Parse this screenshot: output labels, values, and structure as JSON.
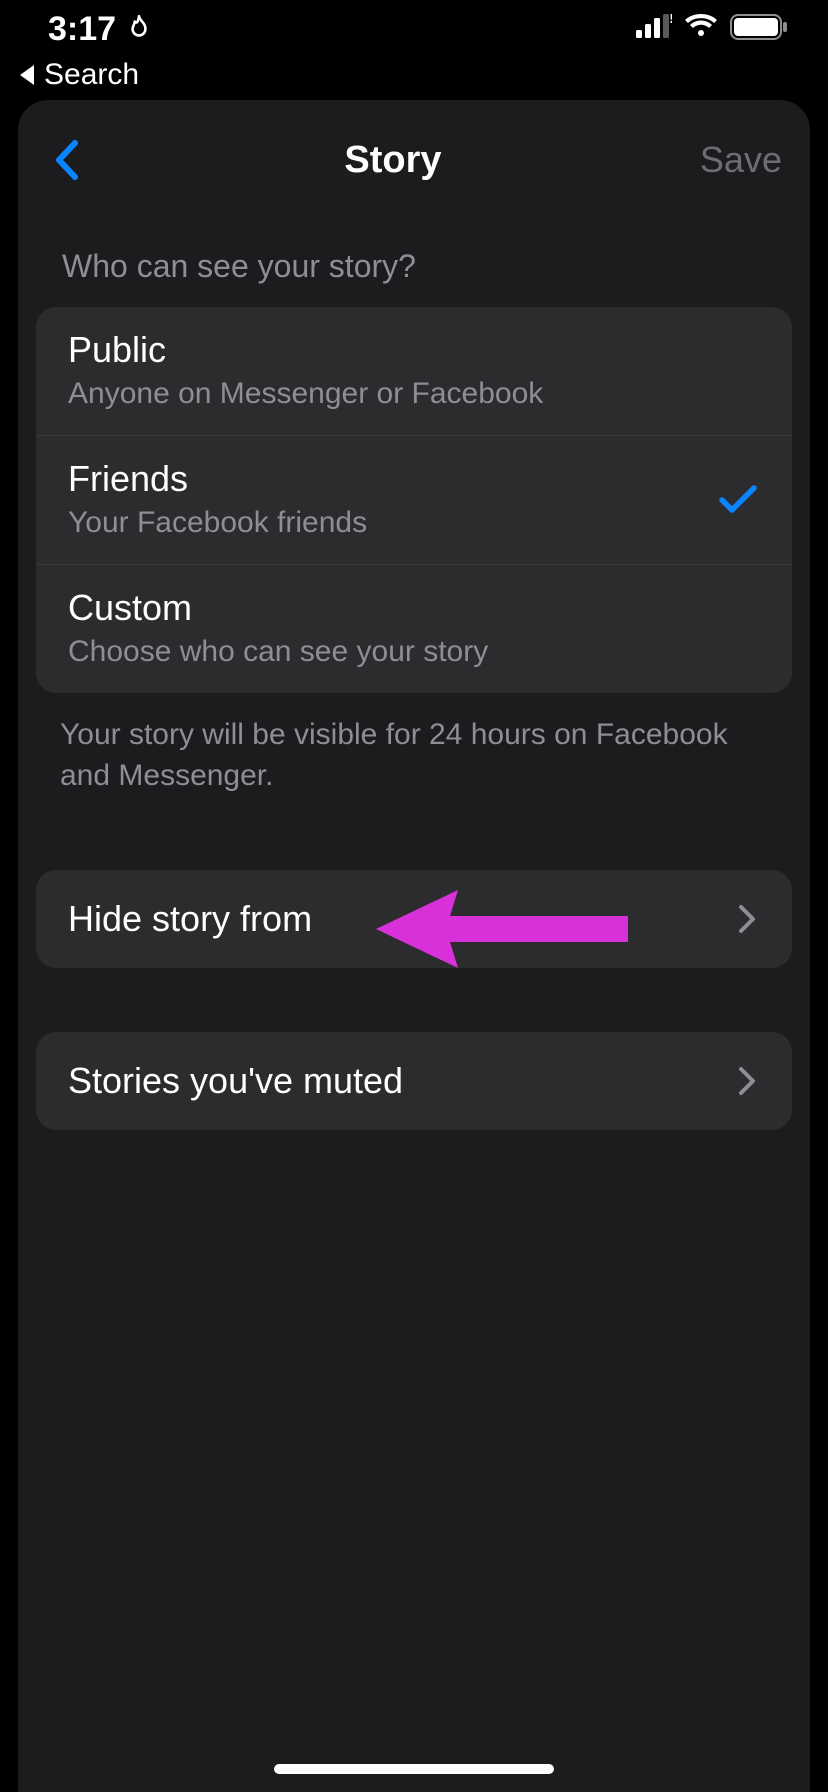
{
  "status": {
    "time": "3:17",
    "back_label": "Search"
  },
  "header": {
    "title": "Story",
    "save_label": "Save"
  },
  "section": {
    "heading": "Who can see your story?",
    "options": [
      {
        "title": "Public",
        "subtitle": "Anyone on Messenger or Facebook",
        "selected": false
      },
      {
        "title": "Friends",
        "subtitle": "Your Facebook friends",
        "selected": true
      },
      {
        "title": "Custom",
        "subtitle": "Choose who can see your story",
        "selected": false
      }
    ],
    "footer": "Your story will be visible for 24 hours on Facebook and Messenger."
  },
  "rows": {
    "hide": "Hide story from",
    "muted": "Stories you've muted"
  },
  "colors": {
    "accent": "#0a84ff",
    "annotation": "#d931d9"
  }
}
